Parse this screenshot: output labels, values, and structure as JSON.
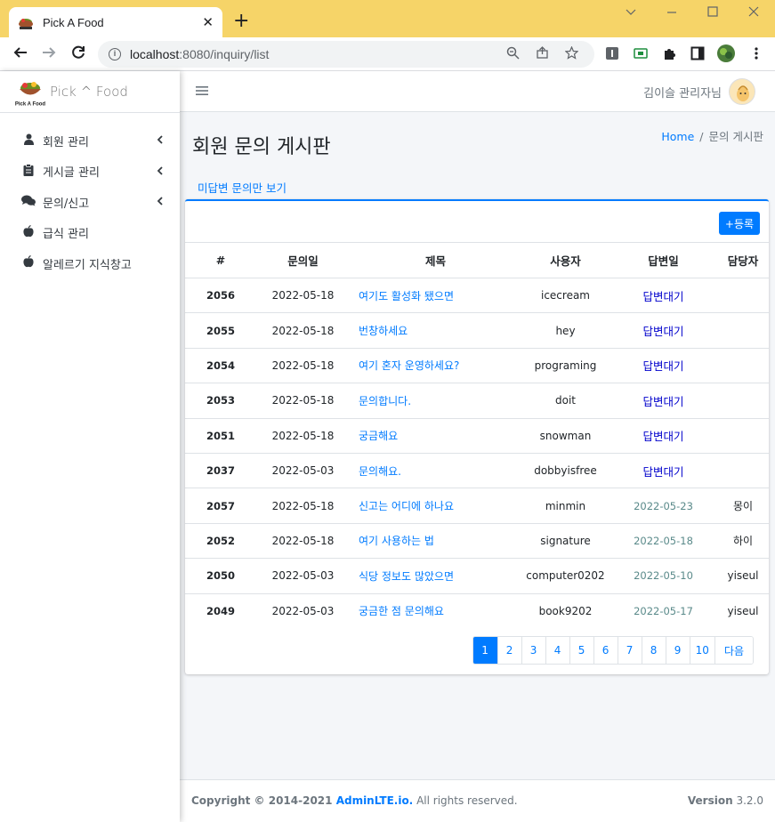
{
  "browser": {
    "tab_title": "Pick A Food",
    "tab_close": "✕",
    "new_tab": "+",
    "url_host": "localhost",
    "url_path": ":8080/inquiry/list"
  },
  "sidebar": {
    "brand": "Pick ^ Food",
    "items": [
      {
        "label": "회원 관리",
        "icon": "user-icon",
        "has_chevron": true
      },
      {
        "label": "게시글 관리",
        "icon": "clipboard-icon",
        "has_chevron": true
      },
      {
        "label": "문의/신고",
        "icon": "comments-icon",
        "has_chevron": true
      },
      {
        "label": "급식 관리",
        "icon": "apple-icon",
        "has_chevron": false
      },
      {
        "label": "알레르기 지식창고",
        "icon": "apple-icon",
        "has_chevron": false
      }
    ]
  },
  "header": {
    "user": "김이슬 관리자님"
  },
  "page": {
    "title": "회원 문의 게시판",
    "breadcrumb_home": "Home",
    "breadcrumb_current": "문의 게시판",
    "tab_unanswered": "미답변 문의만 보기",
    "register_button": "+등록"
  },
  "table": {
    "columns": [
      "#",
      "문의일",
      "제목",
      "사용자",
      "답변일",
      "담당자"
    ],
    "rows": [
      {
        "id": "2056",
        "date": "2022-05-18",
        "title": "여기도 활성화 됐으면",
        "user": "icecream",
        "answer": "답변대기",
        "manager": ""
      },
      {
        "id": "2055",
        "date": "2022-05-18",
        "title": "번창하세요",
        "user": "hey",
        "answer": "답변대기",
        "manager": ""
      },
      {
        "id": "2054",
        "date": "2022-05-18",
        "title": "여기 혼자 운영하세요?",
        "user": "programing",
        "answer": "답변대기",
        "manager": ""
      },
      {
        "id": "2053",
        "date": "2022-05-18",
        "title": "문의합니다.",
        "user": "doit",
        "answer": "답변대기",
        "manager": ""
      },
      {
        "id": "2051",
        "date": "2022-05-18",
        "title": "궁금해요",
        "user": "snowman",
        "answer": "답변대기",
        "manager": ""
      },
      {
        "id": "2037",
        "date": "2022-05-03",
        "title": "문의해요.",
        "user": "dobbyisfree",
        "answer": "답변대기",
        "manager": ""
      },
      {
        "id": "2057",
        "date": "2022-05-18",
        "title": "신고는 어디에 하나요",
        "user": "minmin",
        "answer": "2022-05-23",
        "manager": "몽이"
      },
      {
        "id": "2052",
        "date": "2022-05-18",
        "title": "여기 사용하는 법",
        "user": "signature",
        "answer": "2022-05-18",
        "manager": "하이"
      },
      {
        "id": "2050",
        "date": "2022-05-03",
        "title": "식당 정보도 많았으면",
        "user": "computer0202",
        "answer": "2022-05-10",
        "manager": "yiseul"
      },
      {
        "id": "2049",
        "date": "2022-05-03",
        "title": "궁금한 점 문의해요",
        "user": "book9202",
        "answer": "2022-05-17",
        "manager": "yiseul"
      }
    ]
  },
  "pagination": {
    "pages": [
      "1",
      "2",
      "3",
      "4",
      "5",
      "6",
      "7",
      "8",
      "9",
      "10"
    ],
    "next": "다음",
    "active": "1"
  },
  "footer": {
    "copyright": "Copyright © 2014-2021 ",
    "link": "AdminLTE.io.",
    "rights": " All rights reserved.",
    "version_label": "Version",
    "version": "3.2.0"
  },
  "colors": {
    "primary": "#007bff",
    "tabbar": "#f6d468",
    "waiting": "#0000cc"
  }
}
